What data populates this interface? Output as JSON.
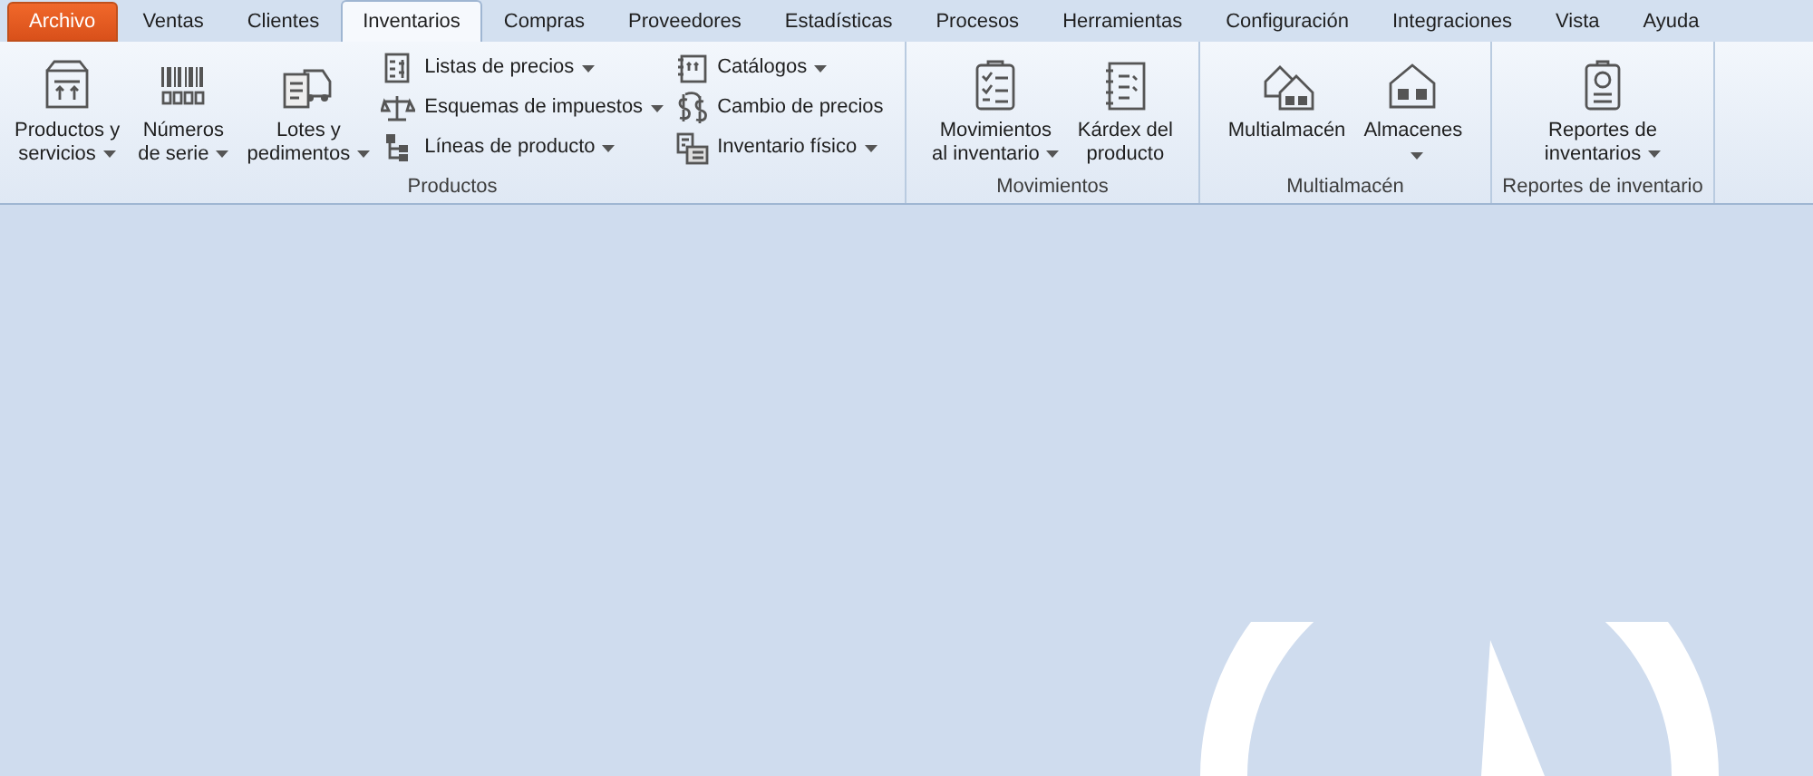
{
  "tabs": [
    {
      "label": "Archivo",
      "kind": "file",
      "selected": false
    },
    {
      "label": "Ventas",
      "kind": "tab",
      "selected": false
    },
    {
      "label": "Clientes",
      "kind": "tab",
      "selected": false
    },
    {
      "label": "Inventarios",
      "kind": "tab",
      "selected": true
    },
    {
      "label": "Compras",
      "kind": "tab",
      "selected": false
    },
    {
      "label": "Proveedores",
      "kind": "tab",
      "selected": false
    },
    {
      "label": "Estadísticas",
      "kind": "tab",
      "selected": false
    },
    {
      "label": "Procesos",
      "kind": "tab",
      "selected": false
    },
    {
      "label": "Herramientas",
      "kind": "tab",
      "selected": false
    },
    {
      "label": "Configuración",
      "kind": "tab",
      "selected": false
    },
    {
      "label": "Integraciones",
      "kind": "tab",
      "selected": false
    },
    {
      "label": "Vista",
      "kind": "tab",
      "selected": false
    },
    {
      "label": "Ayuda",
      "kind": "tab",
      "selected": false
    }
  ],
  "groups": [
    {
      "label": "Productos",
      "items": [
        {
          "kind": "large",
          "lines": [
            "Productos y",
            "servicios"
          ],
          "dropdown": true
        },
        {
          "kind": "large",
          "lines": [
            "Números",
            "de serie"
          ],
          "dropdown": true
        },
        {
          "kind": "large",
          "lines": [
            "Lotes y",
            "pedimentos"
          ],
          "dropdown": true
        },
        {
          "kind": "small",
          "lines": [
            "Listas de precios"
          ],
          "dropdown": true
        },
        {
          "kind": "small",
          "lines": [
            "Esquemas de impuestos"
          ],
          "dropdown": true
        },
        {
          "kind": "small",
          "lines": [
            "Líneas de producto"
          ],
          "dropdown": true
        },
        {
          "kind": "small",
          "lines": [
            "Catálogos"
          ],
          "dropdown": true
        },
        {
          "kind": "small",
          "lines": [
            "Cambio de precios"
          ],
          "dropdown": false
        },
        {
          "kind": "small",
          "lines": [
            "Inventario físico"
          ],
          "dropdown": true
        }
      ]
    },
    {
      "label": "Movimientos",
      "items": [
        {
          "kind": "large",
          "lines": [
            "Movimientos",
            "al inventario"
          ],
          "dropdown": true
        },
        {
          "kind": "large",
          "lines": [
            "Kárdex del",
            "producto"
          ],
          "dropdown": false
        }
      ]
    },
    {
      "label": "Multialmacén",
      "items": [
        {
          "kind": "large",
          "lines": [
            "Multialmacén"
          ],
          "dropdown": false
        },
        {
          "kind": "large",
          "lines": [
            "Almacenes"
          ],
          "dropdown": true
        }
      ]
    },
    {
      "label": "Reportes de inventario",
      "items": [
        {
          "kind": "large",
          "lines": [
            "Reportes de",
            "inventarios"
          ],
          "dropdown": true
        }
      ]
    }
  ]
}
